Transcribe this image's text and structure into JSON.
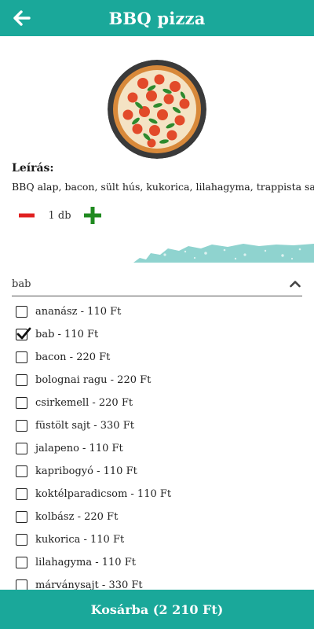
{
  "header": {
    "title": "BBQ pizza",
    "back_icon": "arrow-left-icon"
  },
  "colors": {
    "primary": "#1aa89a",
    "minus": "#e02020",
    "plus": "#1f8a1f"
  },
  "product": {
    "image_icon": "pizza-image",
    "description_title": "Leírás:",
    "description_text": "BBQ alap, bacon, sült hús, kukorica, lilahagyma, trappista sajt",
    "quantity": "1 db"
  },
  "extras": {
    "selected_value": "bab",
    "expanded": true,
    "options": [
      {
        "label": "ananász - 110 Ft",
        "checked": false
      },
      {
        "label": "bab - 110 Ft",
        "checked": true
      },
      {
        "label": "bacon - 220 Ft",
        "checked": false
      },
      {
        "label": "bolognai ragu - 220 Ft",
        "checked": false
      },
      {
        "label": "csirkemell - 220 Ft",
        "checked": false
      },
      {
        "label": "füstölt sajt - 330 Ft",
        "checked": false
      },
      {
        "label": "jalapeno - 110 Ft",
        "checked": false
      },
      {
        "label": "kapribogyó - 110 Ft",
        "checked": false
      },
      {
        "label": "koktélparadicsom - 110 Ft",
        "checked": false
      },
      {
        "label": "kolbász - 220 Ft",
        "checked": false
      },
      {
        "label": "kukorica - 110 Ft",
        "checked": false
      },
      {
        "label": "lilahagyma - 110 Ft",
        "checked": false
      },
      {
        "label": "márványsajt - 330 Ft",
        "checked": false
      }
    ]
  },
  "footer": {
    "cart_button_label": "Kosárba (2 210 Ft)"
  }
}
